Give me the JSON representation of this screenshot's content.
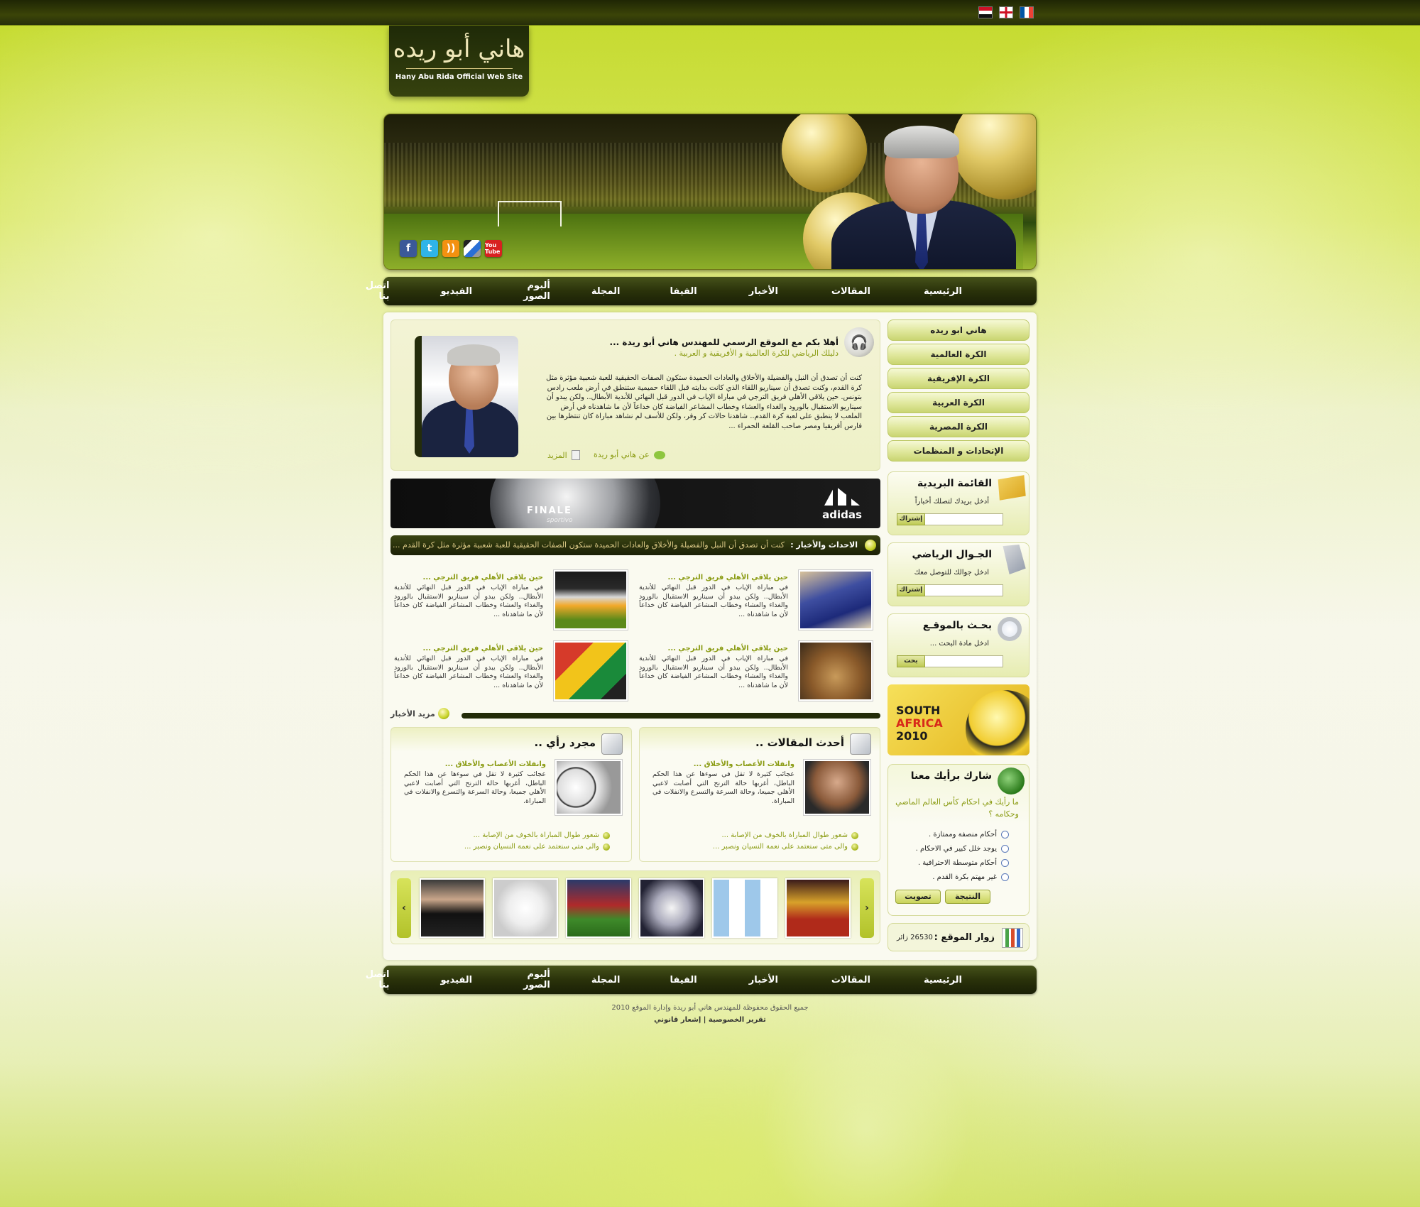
{
  "site": {
    "logo_ar": "هاني أبو ريده",
    "logo_en": "Hany Abu Rida Official Web Site"
  },
  "flags": [
    "egypt-flag",
    "england-flag",
    "france-flag"
  ],
  "social": [
    "facebook-icon",
    "twitter-icon",
    "rss-icon",
    "delicious-icon",
    "youtube-icon"
  ],
  "social_labels": {
    "facebook": "f",
    "twitter": "t",
    "rss": "))",
    "youtube": "You Tube"
  },
  "nav": [
    "الرئيسية",
    "المقالات",
    "الأخبار",
    "الفيفا",
    "المجلة",
    "ألبوم الصور",
    "الفيديو",
    "اتصل بنا"
  ],
  "welcome": {
    "title": "أهلا بكم مع الموقع الرسمي للمهندس هاني أبو ريدة ...",
    "subtitle": "دليلك الرياضي للكرة العالمية و الأفريقية و العربية .",
    "body": "كنت أن تصدق أن النبل والفضيلة والأخلاق والعادات الحميدة ستكون الصفات الحقيقية للعبة شعبية مؤثرة مثل كرة القدم، وكنت تصدق أن سيناريو اللقاء الذي كانت بدايته قبل اللقاء حميمية ستنطق في أرض ملعب رادس بتونس. حين يلاقي الأهلي فريق الترجي في مباراة الإياب في الدور قبل النهائي للأندية الأبطال.. ولكن يبدو أن سيناريو الاستقبال بالورود والغداء والعشاء وخطاب المشاعر الفياضة كان خداعاً لأن ما شاهدناه في أرض الملعب لا ينطبق على لعبة كرة القدم.. شاهدنا حالات كر وفر، ولكن للأسف لم نشاهد مباراة كان تنتظرها بين فارس أفريقيا ومصر صاحب القلعة الحمراء ...",
    "about": "عن هاني أبو ريدة",
    "more": "المزيد"
  },
  "ad": {
    "brand": "adidas",
    "product": "FINALE",
    "product_sub": "sportivo"
  },
  "ticker": {
    "label": "الاحداث والأخبار :",
    "text": "كنت أن تصدق أن النبل والفضيلة والأخلاق والعادات الحميدة ستكون الصفات الحقيقية للعبة شعبية مؤثرة مثل كرة القدم ..."
  },
  "news": [
    {
      "title": "حين يلاقي الأهلي فريق الترجي ...",
      "body": "في مباراة الإياب في الدور قبل النهائي للأندية الأبطال.. ولكن يبدو أن سيناريو الاستقبال بالورود والغداء والعشاء وخطاب المشاعر الفياضة كان خداعاً لأن ما شاهدناه ..."
    },
    {
      "title": "حين يلاقي الأهلي فريق الترجي ...",
      "body": "في مباراة الإياب في الدور قبل النهائي للأندية الأبطال.. ولكن يبدو أن سيناريو الاستقبال بالورود والغداء والعشاء وخطاب المشاعر الفياضة كان خداعاً لأن ما شاهدناه ..."
    },
    {
      "title": "حين يلاقي الأهلي فريق الترجي ...",
      "body": "في مباراة الإياب في الدور قبل النهائي للأندية الأبطال.. ولكن يبدو أن سيناريو الاستقبال بالورود والغداء والعشاء وخطاب المشاعر الفياضة كان خداعاً لأن ما شاهدناه ..."
    },
    {
      "title": "حين يلاقي الأهلي فريق الترجي ...",
      "body": "في مباراة الإياب في الدور قبل النهائي للأندية الأبطال.. ولكن يبدو أن سيناريو الاستقبال بالورود والغداء والعشاء وخطاب المشاعر الفياضة كان خداعاً لأن ما شاهدناه ..."
    }
  ],
  "more_news": "مزيد الأخبار",
  "articles": {
    "title": "أحدث المقالات ..",
    "headline": "وانفلات الأعصاب والأخلاق ...",
    "body": "عجائب كثيرة لا تقل في سوءها عن هذا الحكم الباطل، أغربها حالة الترنح التي أصابت لاعبي الأهلي جميعا، وحالة السرعة والتسرع والانفلات في المباراة.",
    "links": [
      "شعور طوال المباراة بالخوف من الإصابة ...",
      "والى متى سنعتمد على نعمة النسيان ونصبر ..."
    ]
  },
  "opinion": {
    "title": "مجرد رأي ..",
    "headline": "وانفلات الأعصاب والأخلاق ...",
    "body": "عجائب كثيرة لا تقل في سوءها عن هذا الحكم الباطل، أغربها حالة الترنح التي أصابت لاعبي الأهلي جميعا، وحالة السرعة والتسرع والانفلات في المباراة.",
    "links": [
      "شعور طوال المباراة بالخوف من الإصابة ...",
      "والى متى سنعتمد على نعمة النسيان ونصبر ..."
    ]
  },
  "gallery": {
    "prev": "‹",
    "next": "›"
  },
  "sidebar": {
    "links": [
      "هاني ابو ريده",
      "الكرة العالمية",
      "الكرة الإفريقية",
      "الكرة العربية",
      "الكرة المصرية",
      "الإتحادات و المنظمات"
    ],
    "mailing": {
      "title": "القائمة البريدية",
      "prompt": "أدخل بريدك لتصلك أخباراً",
      "button": "إشتراك"
    },
    "mobile": {
      "title": "الجـوال الرياضي",
      "prompt": "ادخل جوالك للتوصل معك",
      "button": "إشتراك"
    },
    "search": {
      "title": "بحـث بالموقـع",
      "prompt": "ادخل مادة البحث ...",
      "button": "بحث"
    },
    "promo": {
      "line1": "SOUTH",
      "line2": "AFRICA",
      "line3": "2010"
    },
    "poll": {
      "title": "شارك برأيك معنا",
      "question": "ما رأيك في احكام كأس العالم الماضي وحكامه ؟",
      "options": [
        "أحكام منصفة وممتازة .",
        "يوجد خلل كبير في الاحكام .",
        "أحكام متوسطة الاحترافية .",
        "غير مهتم بكرة القدم ."
      ],
      "vote": "تصويت",
      "results": "النتيجة"
    },
    "visitors": {
      "label": "زوار الموقع :",
      "count": "26530 زائر"
    }
  },
  "footer": {
    "copyright": "جميع الحقوق محفوظة للمهندس هاني أبو ريدة وإدارة الموقع 2010",
    "privacy": "تقرير الخصوصية",
    "legal": "إشعار قانوني",
    "sep": "|"
  }
}
